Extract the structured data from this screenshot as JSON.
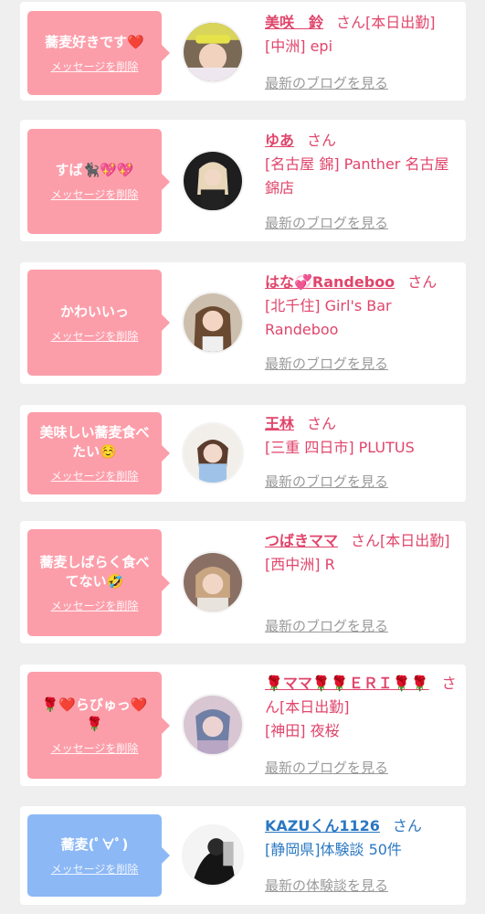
{
  "colors": {
    "pink_bubble": "#fc9eaa",
    "blue_bubble": "#8cb8f6",
    "name_pink": "#e0456b",
    "name_blue": "#2b78c2",
    "link_gray": "#9a9a9a"
  },
  "cards": [
    {
      "message": "蕎麦好きです❤️",
      "delete_label": "メッセージを削除",
      "name": "美咲　鈴",
      "san": "さん",
      "badge": "[本日出勤]",
      "shop": "[中洲] epi",
      "blog_link": "最新のブログを見る"
    },
    {
      "message": "すば🐈‍⬛💖💖",
      "delete_label": "メッセージを削除",
      "name": "ゆあ",
      "san": "さん",
      "badge": "",
      "shop": "[名古屋 錦] Panther 名古屋錦店",
      "blog_link": "最新のブログを見る"
    },
    {
      "message": "かわいいっ",
      "delete_label": "メッセージを削除",
      "name": "はな💞Randeboo",
      "san": "さん",
      "badge": "",
      "shop": "[北千住] Girl's Bar Randeboo",
      "blog_link": "最新のブログを見る"
    },
    {
      "message": "美味しい蕎麦食べたい☺️",
      "delete_label": "メッセージを削除",
      "name": "王林",
      "san": "さん",
      "badge": "",
      "shop": "[三重 四日市] PLUTUS",
      "blog_link": "最新のブログを見る"
    },
    {
      "message": "蕎麦しばらく食べてない🤣",
      "delete_label": "メッセージを削除",
      "name": "つばきママ",
      "san": "さん",
      "badge": "[本日出勤]",
      "shop": "[西中洲] R",
      "blog_link": "最新のブログを見る"
    },
    {
      "message": "🌹❤️らびゅっ❤️🌹",
      "delete_label": "メッセージを削除",
      "name": "🌹ママ🌹🌹ＥＲＩ🌹🌹",
      "san": "さん",
      "badge": "[本日出勤]",
      "shop": "[神田] 夜桜",
      "blog_link": "最新のブログを見る"
    },
    {
      "message": "蕎麦(ﾟ∀ﾟ)",
      "delete_label": "メッセージを削除",
      "name": "KAZUくん1126",
      "san": "さん",
      "badge": "",
      "shop": "[静岡県]体験談 50件",
      "blog_link": "最新の体験談を見る"
    }
  ]
}
